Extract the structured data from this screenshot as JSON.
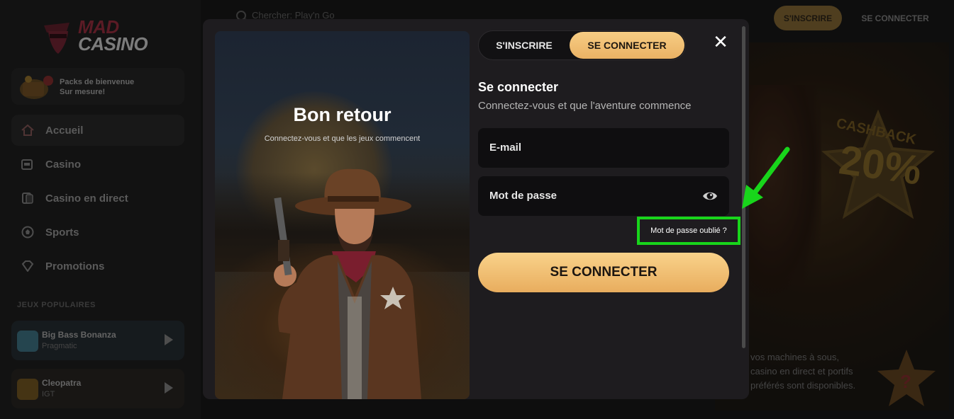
{
  "sidebar": {
    "logo": {
      "line1": "MAD",
      "line2": "CASINO"
    },
    "welcome": {
      "line1": "Packs de bienvenue",
      "line2": "Sur mesure!"
    },
    "nav": [
      {
        "label": "Accueil",
        "icon": "home-icon"
      },
      {
        "label": "Casino",
        "icon": "slot-machine-icon"
      },
      {
        "label": "Casino en direct",
        "icon": "cards-icon"
      },
      {
        "label": "Sports",
        "icon": "soccer-ball-icon"
      },
      {
        "label": "Promotions",
        "icon": "diamond-icon"
      }
    ],
    "section_title": "JEUX POPULAIRES",
    "games": [
      {
        "name": "Big Bass Bonanza",
        "provider": "Pragmatic"
      },
      {
        "name": "Cleopatra",
        "provider": "IGT"
      }
    ]
  },
  "topbar": {
    "search_placeholder": "Chercher: Play'n Go",
    "signup_label": "S'INSCRIRE",
    "login_label": "SE CONNECTER"
  },
  "background": {
    "cashback_label": "CASHBACK",
    "cashback_value": "20%",
    "promo_text": "vos machines à sous, casino en direct et portifs préférés sont disponibles."
  },
  "modal": {
    "hero_title": "Bon retour",
    "hero_subtitle": "Connectez-vous et que les jeux commencent",
    "tabs": {
      "signup": "S'INSCRIRE",
      "login": "SE CONNECTER"
    },
    "active_tab": "login",
    "close_symbol": "✕",
    "form_title": "Se connecter",
    "form_subtitle": "Connectez-vous et que l'aventure commence",
    "email_placeholder": "E-mail",
    "password_placeholder": "Mot de passe",
    "forgot_label": "Mot de passe oublié ?",
    "submit_label": "SE CONNECTER"
  },
  "colors": {
    "accent_gold": "#f0be70",
    "highlight_green": "#18d51b",
    "modal_bg": "#1e1c1f"
  }
}
